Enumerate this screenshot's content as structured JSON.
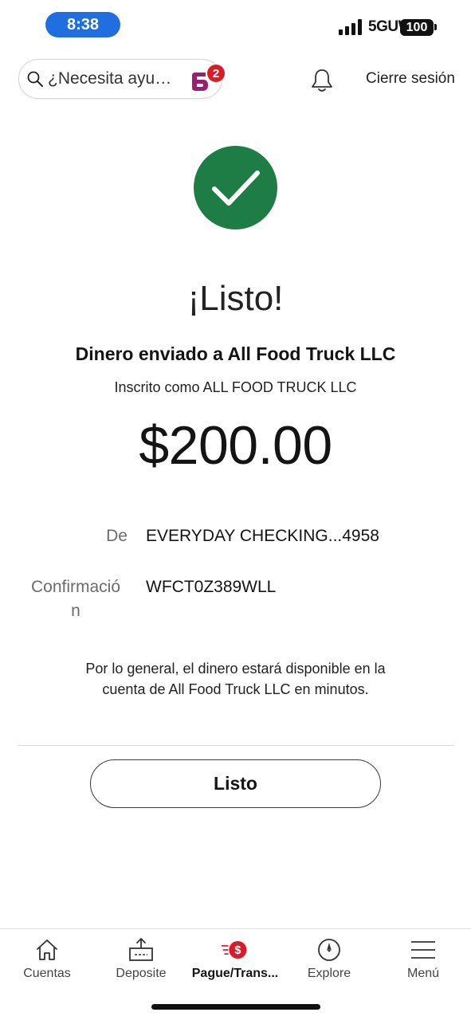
{
  "status_bar": {
    "time": "8:38",
    "network": "5GUW",
    "battery": "100"
  },
  "header": {
    "search_placeholder": "¿Necesita ayu…",
    "notification_count": "2",
    "logout_label": "Cierre sesión"
  },
  "success": {
    "icon": "checkmark-icon",
    "headline": "¡Listo!",
    "recipient_line": "Dinero enviado a All Food Truck LLC",
    "enrolled_line": "Inscrito como ALL FOOD TRUCK LLC",
    "amount": "$200.00"
  },
  "details": {
    "from_label": "De",
    "from_value": "EVERYDAY CHECKING...4958",
    "confirmation_label": "Confirmació\nn",
    "confirmation_value": "WFCT0Z389WLL"
  },
  "availability_note": "Por lo general, el dinero estará disponible en la cuenta de All Food Truck LLC en minutos.",
  "done_button_label": "Listo",
  "bottom_nav": {
    "items": [
      {
        "label": "Cuentas",
        "icon": "home-icon"
      },
      {
        "label": "Deposite",
        "icon": "deposit-icon"
      },
      {
        "label": "Pague/Trans...",
        "icon": "pay-transfer-icon",
        "active": true
      },
      {
        "label": "Explore",
        "icon": "compass-icon"
      },
      {
        "label": "Menú",
        "icon": "menu-icon"
      }
    ]
  },
  "colors": {
    "success_green": "#1e7d45",
    "brand_red": "#d71e28",
    "status_time_blue": "#1f6fe0",
    "fargo_purple": "#9c1f6f"
  }
}
